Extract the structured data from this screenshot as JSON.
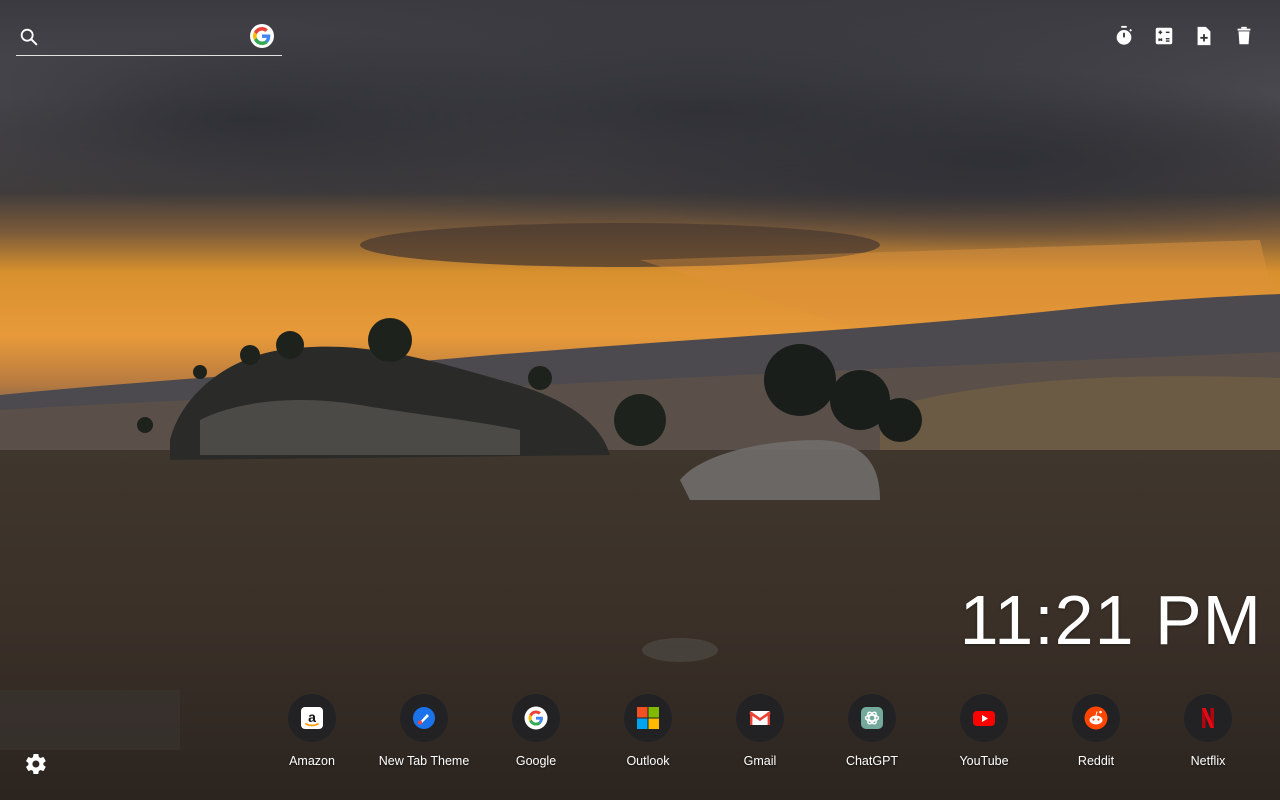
{
  "search": {
    "placeholder": "",
    "value": "",
    "engine_icon": "google-g-icon"
  },
  "toolbar": [
    {
      "name": "timer-button",
      "icon": "timer-icon"
    },
    {
      "name": "calculator-button",
      "icon": "calculator-icon"
    },
    {
      "name": "new-note-button",
      "icon": "note-add-icon"
    },
    {
      "name": "delete-button",
      "icon": "trash-icon"
    }
  ],
  "clock": {
    "time": "11:21 PM"
  },
  "shortcuts": [
    {
      "label": "Amazon",
      "icon": "amazon-icon",
      "color": "#ffffff"
    },
    {
      "label": "New Tab Theme",
      "icon": "new-tab-theme-icon",
      "color": "#1a73e8"
    },
    {
      "label": "Google",
      "icon": "google-icon",
      "color": "#ffffff"
    },
    {
      "label": "Outlook",
      "icon": "microsoft-icon",
      "color": "#f25022"
    },
    {
      "label": "Gmail",
      "icon": "gmail-icon",
      "color": "#ea4335"
    },
    {
      "label": "ChatGPT",
      "icon": "chatgpt-icon",
      "color": "#74aa9c"
    },
    {
      "label": "YouTube",
      "icon": "youtube-icon",
      "color": "#ff0000"
    },
    {
      "label": "Reddit",
      "icon": "reddit-icon",
      "color": "#ff4500"
    },
    {
      "label": "Netflix",
      "icon": "netflix-icon",
      "color": "#e50914"
    }
  ],
  "settings": {
    "icon": "gear-icon"
  }
}
